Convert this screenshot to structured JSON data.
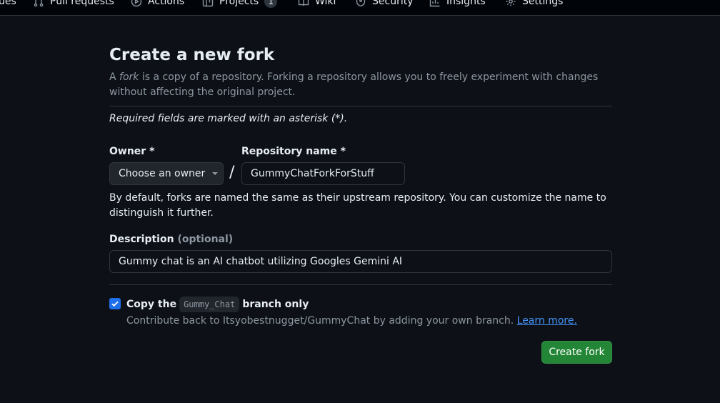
{
  "nav": {
    "items": [
      {
        "label": "ues",
        "icon": ""
      },
      {
        "label": "Pull requests",
        "icon": "pull-request-icon"
      },
      {
        "label": "Actions",
        "icon": "actions-icon"
      },
      {
        "label": "Projects",
        "icon": "projects-icon",
        "counter": "1"
      },
      {
        "label": "Wiki",
        "icon": "wiki-icon"
      },
      {
        "label": "Security",
        "icon": "shield-icon"
      },
      {
        "label": "Insights",
        "icon": "graph-icon"
      },
      {
        "label": "Settings",
        "icon": "gear-icon"
      }
    ]
  },
  "page": {
    "title": "Create a new fork",
    "intro_prefix": "A ",
    "intro_em": "fork",
    "intro_rest": " is a copy of a repository. Forking a repository allows you to freely experiment with changes without affecting the original project.",
    "required_note": "Required fields are marked with an asterisk (*)."
  },
  "form": {
    "owner_label": "Owner *",
    "owner_value": "Choose an owner",
    "separator": "/",
    "repo_label": "Repository name *",
    "repo_value": "GummyChatForkForStuff",
    "name_hint": "By default, forks are named the same as their upstream repository. You can customize the name to distinguish it further.",
    "description_label": "Description",
    "description_optional": "(optional)",
    "description_value": "Gummy chat is an AI chatbot utilizing Googles Gemini AI",
    "copy_checked": true,
    "copy_prefix": "Copy the",
    "copy_branch": "Gummy_Chat",
    "copy_suffix": "branch only",
    "contrib_text": "Contribute back to Itsyobestnugget/GummyChat by adding your own branch.",
    "learn_more": "Learn more.",
    "create_button": "Create fork"
  },
  "colors": {
    "background": "#0d1117",
    "primary_button": "#238636",
    "checkbox": "#1f6feb",
    "link": "#4493f8"
  }
}
